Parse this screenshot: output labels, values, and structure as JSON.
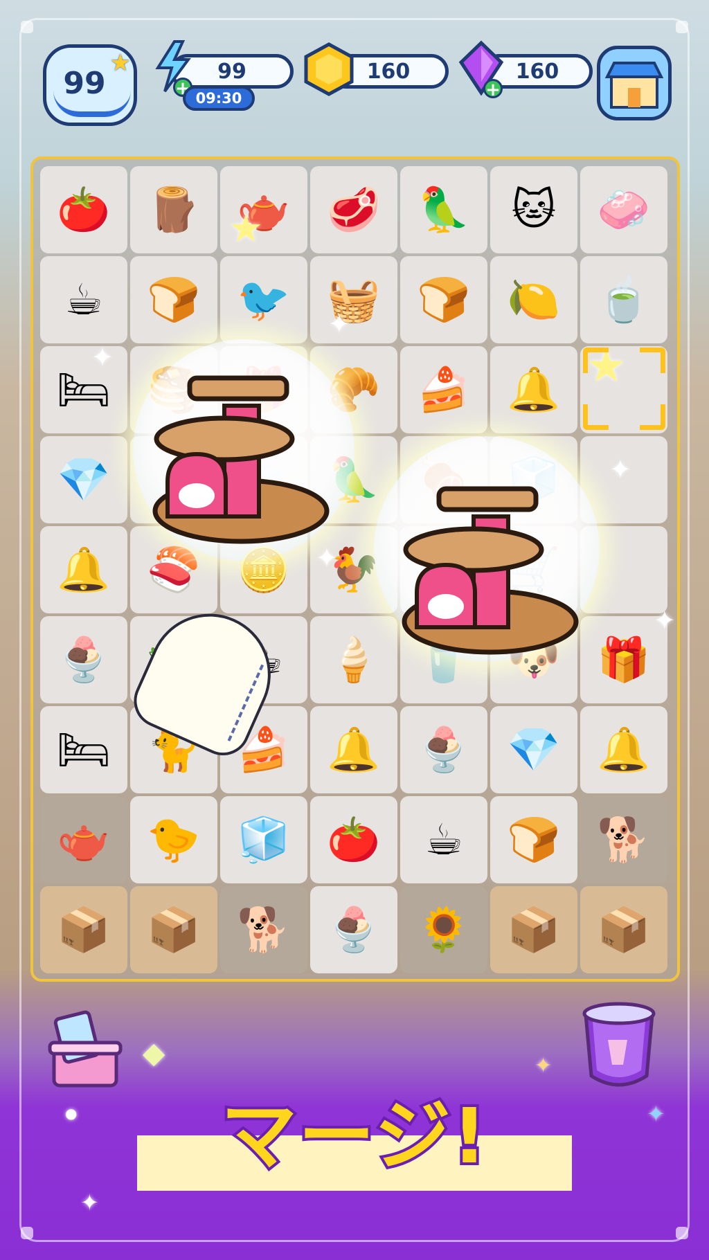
{
  "hud": {
    "level": "99",
    "energy": {
      "value": "99",
      "timer": "09:30",
      "icon": "lightning-icon"
    },
    "coins": {
      "value": "160",
      "icon": "coin-icon"
    },
    "gems": {
      "value": "160",
      "icon": "gem-icon"
    },
    "shop_icon": "shop-icon"
  },
  "board": {
    "rows": 9,
    "cols": 7,
    "cells": [
      [
        {
          "item": "tomato",
          "g": "🍅",
          "s": "open"
        },
        {
          "item": "cat-tower",
          "g": "🪵",
          "s": "open"
        },
        {
          "item": "teapot",
          "g": "🫖",
          "s": "open"
        },
        {
          "item": "steak",
          "g": "🥩",
          "s": "open"
        },
        {
          "item": "cockatoo",
          "g": "🦜",
          "s": "open"
        },
        {
          "item": "pink-cat",
          "g": "🐱",
          "s": "open"
        },
        {
          "item": "soap",
          "g": "🧼",
          "s": "open"
        }
      ],
      [
        {
          "item": "coffee-cup",
          "g": "☕",
          "s": "open"
        },
        {
          "item": "bread-bun",
          "g": "🍞",
          "s": "open"
        },
        {
          "item": "robin",
          "g": "🐦",
          "s": "open"
        },
        {
          "item": "food-basket",
          "g": "🧺",
          "s": "open"
        },
        {
          "item": "bread-bun",
          "g": "🍞",
          "s": "open"
        },
        {
          "item": "lemonade",
          "g": "🍋",
          "s": "open"
        },
        {
          "item": "tea-bag",
          "g": "🍵",
          "s": "open"
        }
      ],
      [
        {
          "item": "pet-bed",
          "g": "🛏",
          "s": "open"
        },
        {
          "item": "pancakes",
          "g": "🥞",
          "s": "open"
        },
        {
          "item": "toy-box",
          "g": "🎁",
          "s": "open"
        },
        {
          "item": "croissant",
          "g": "🥐",
          "s": "open"
        },
        {
          "item": "orange-cake",
          "g": "🍰",
          "s": "open"
        },
        {
          "item": "bell-collar",
          "g": "🔔",
          "s": "open"
        },
        {
          "item": "",
          "g": "",
          "s": "open"
        }
      ],
      [
        {
          "item": "purple-gem",
          "g": "💎",
          "s": "open"
        },
        {
          "item": "",
          "g": "",
          "s": "open"
        },
        {
          "item": "leaf",
          "g": "🍃",
          "s": "open"
        },
        {
          "item": "parrot",
          "g": "🦜",
          "s": "open"
        },
        {
          "item": "ham",
          "g": "🍖",
          "s": "open"
        },
        {
          "item": "meat-fridge",
          "g": "🧊",
          "s": "open"
        },
        {
          "item": "",
          "g": "",
          "s": "open"
        }
      ],
      [
        {
          "item": "bell-collar",
          "g": "🔔",
          "s": "open"
        },
        {
          "item": "sushi",
          "g": "🍣",
          "s": "open"
        },
        {
          "item": "coins",
          "g": "🪙",
          "s": "open"
        },
        {
          "item": "rooster",
          "g": "🐓",
          "s": "open"
        },
        {
          "item": "",
          "g": "",
          "s": "open"
        },
        {
          "item": "stroller",
          "g": "🛒",
          "s": "open"
        },
        {
          "item": "",
          "g": "",
          "s": "open"
        }
      ],
      [
        {
          "item": "parfait",
          "g": "🍨",
          "s": "open"
        },
        {
          "item": "salad-plate",
          "g": "🥗",
          "s": "open"
        },
        {
          "item": "coffee-set",
          "g": "☕",
          "s": "open"
        },
        {
          "item": "cream-coffee",
          "g": "🍦",
          "s": "open"
        },
        {
          "item": "juice",
          "g": "🥤",
          "s": "open"
        },
        {
          "item": "puppy",
          "g": "🐶",
          "s": "open"
        },
        {
          "item": "gift-box",
          "g": "🎁",
          "s": "open"
        }
      ],
      [
        {
          "item": "pet-bed",
          "g": "🛏",
          "s": "open"
        },
        {
          "item": "calico-cat",
          "g": "🐈",
          "s": "open"
        },
        {
          "item": "orange-cake",
          "g": "🍰",
          "s": "open"
        },
        {
          "item": "bell-collar",
          "g": "🔔",
          "s": "open"
        },
        {
          "item": "parfait",
          "g": "🍨",
          "s": "open"
        },
        {
          "item": "purple-gem",
          "g": "💎",
          "s": "open"
        },
        {
          "item": "bell-collar",
          "g": "🔔",
          "s": "open"
        }
      ],
      [
        {
          "item": "coffee-machine",
          "g": "🫖",
          "s": "locked"
        },
        {
          "item": "chick",
          "g": "🐤",
          "s": "open"
        },
        {
          "item": "meat-fridge",
          "g": "🧊",
          "s": "open"
        },
        {
          "item": "tomato",
          "g": "🍅",
          "s": "open"
        },
        {
          "item": "coffee-cup",
          "g": "☕",
          "s": "open"
        },
        {
          "item": "bread-bun",
          "g": "🍞",
          "s": "open"
        },
        {
          "item": "shiba-black",
          "g": "🐕",
          "s": "locked"
        }
      ],
      [
        {
          "item": "cardboard-box",
          "g": "📦",
          "s": "box"
        },
        {
          "item": "cardboard-box",
          "g": "📦",
          "s": "box"
        },
        {
          "item": "shiba",
          "g": "🐕",
          "s": "locked"
        },
        {
          "item": "parfait",
          "g": "🍨",
          "s": "open"
        },
        {
          "item": "bird-cage",
          "g": "🌻",
          "s": "locked"
        },
        {
          "item": "cardboard-box",
          "g": "📦",
          "s": "box"
        },
        {
          "item": "cardboard-box",
          "g": "📦",
          "s": "box"
        }
      ]
    ]
  },
  "merge_highlight": {
    "item": "cat-tower",
    "icon": "cat-tower-icon"
  },
  "tools": {
    "left_icon": "card-box-icon",
    "right_icon": "shield-trash-icon"
  },
  "banner": {
    "text": "マージ!"
  }
}
